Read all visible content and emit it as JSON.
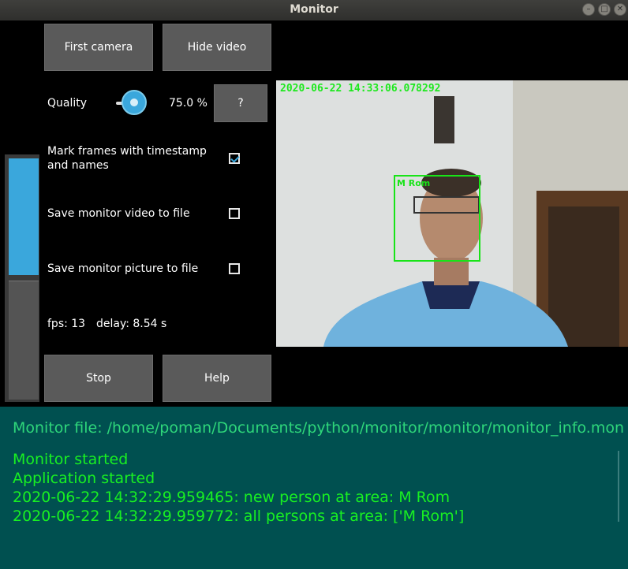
{
  "window": {
    "title": "Monitor"
  },
  "buttons": {
    "first_camera": "First camera",
    "hide_video": "Hide video",
    "help_q": "?",
    "stop": "Stop",
    "help": "Help"
  },
  "quality": {
    "label": "Quality",
    "value_text": "75.0 %",
    "value_pct": 75
  },
  "options": {
    "mark_frames": {
      "label_line1": "Mark frames with timestamp",
      "label_line2": "and names",
      "checked": true
    },
    "save_video": {
      "label": "Save monitor video to file",
      "checked": false
    },
    "save_picture": {
      "label": "Save monitor picture to file",
      "checked": false
    }
  },
  "stats": {
    "fps": "fps: 13",
    "delay": "delay: 8.54 s"
  },
  "video": {
    "timestamp": "2020-06-22 14:33:06.078292",
    "face_label": "M Rom"
  },
  "console": {
    "monitor_file": "Monitor file: /home/poman/Documents/python/monitor/monitor/monitor_info.mon",
    "lines": [
      "Monitor started",
      "Application started",
      "2020-06-22 14:32:29.959465: new person at area: M Rom",
      "2020-06-22 14:32:29.959772: all persons at area: ['M Rom']"
    ]
  },
  "colors": {
    "accent": "#3aa7dc",
    "console_bg": "#005050",
    "console_text": "#18f022",
    "face_box": "#18e418"
  }
}
